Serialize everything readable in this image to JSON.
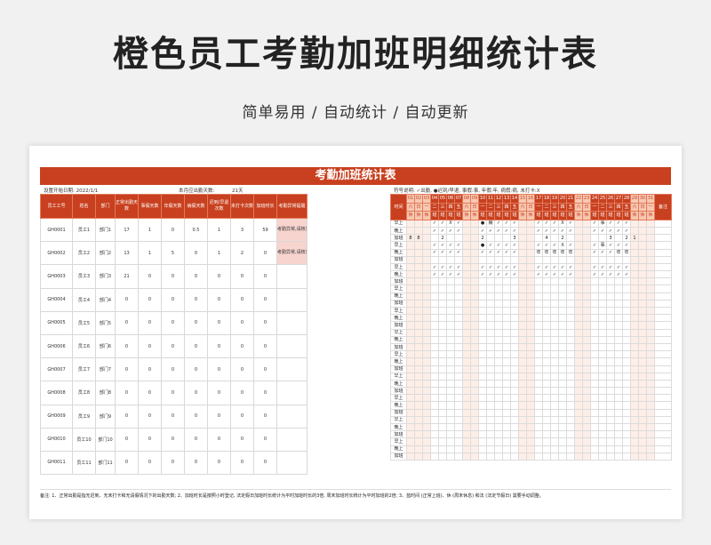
{
  "title": "橙色员工考勤加班明细统计表",
  "subtitle": "简单易用 / 自动统计 / 自动更新",
  "sheet": {
    "banner": "考勤加班统计表",
    "meta_start": "设置开始日期: 2022/1/1",
    "meta_days": "本月应出勤天数:",
    "meta_days_value": "21天",
    "meta_legend": "符号说明: ✓出勤, ●迟到/早退, 事假:事, 年假:年, 病假:病, 未打卡:X",
    "headers": [
      "员工工号",
      "姓名",
      "部门",
      "正常出勤天数",
      "事假天数",
      "年假天数",
      "病假天数",
      "迟到/早退次数",
      "未打卡次数",
      "加班时长",
      "考勤异常提醒",
      "时间"
    ],
    "employees": [
      {
        "id": "GH0001",
        "name": "员工1",
        "dept": "部门1",
        "normal": "17",
        "personal": "1",
        "annual": "0",
        "sick": "0.5",
        "late": "1",
        "missed": "3",
        "ot": "59",
        "remark": "考勤异常,请核实"
      },
      {
        "id": "GH0002",
        "name": "员工2",
        "dept": "部门2",
        "normal": "13",
        "personal": "1",
        "annual": "5",
        "sick": "0",
        "late": "1",
        "missed": "2",
        "ot": "0",
        "remark": "考勤异常,请核实"
      },
      {
        "id": "GH0003",
        "name": "员工3",
        "dept": "部门3",
        "normal": "21",
        "personal": "0",
        "annual": "0",
        "sick": "0",
        "late": "0",
        "missed": "0",
        "ot": "0",
        "remark": ""
      },
      {
        "id": "GH0004",
        "name": "员工4",
        "dept": "部门4",
        "normal": "0",
        "personal": "0",
        "annual": "0",
        "sick": "0",
        "late": "0",
        "missed": "0",
        "ot": "0",
        "remark": ""
      },
      {
        "id": "GH0005",
        "name": "员工5",
        "dept": "部门5",
        "normal": "0",
        "personal": "0",
        "annual": "0",
        "sick": "0",
        "late": "0",
        "missed": "0",
        "ot": "0",
        "remark": ""
      },
      {
        "id": "GH0006",
        "name": "员工6",
        "dept": "部门6",
        "normal": "0",
        "personal": "0",
        "annual": "0",
        "sick": "0",
        "late": "0",
        "missed": "0",
        "ot": "0",
        "remark": ""
      },
      {
        "id": "GH0007",
        "name": "员工7",
        "dept": "部门7",
        "normal": "0",
        "personal": "0",
        "annual": "0",
        "sick": "0",
        "late": "0",
        "missed": "0",
        "ot": "0",
        "remark": ""
      },
      {
        "id": "GH0008",
        "name": "员工8",
        "dept": "部门8",
        "normal": "0",
        "personal": "0",
        "annual": "0",
        "sick": "0",
        "late": "0",
        "missed": "0",
        "ot": "0",
        "remark": ""
      },
      {
        "id": "GH0009",
        "name": "员工9",
        "dept": "部门9",
        "normal": "0",
        "personal": "0",
        "annual": "0",
        "sick": "0",
        "late": "0",
        "missed": "0",
        "ot": "0",
        "remark": ""
      },
      {
        "id": "GH0010",
        "name": "员工10",
        "dept": "部门10",
        "normal": "0",
        "personal": "0",
        "annual": "0",
        "sick": "0",
        "late": "0",
        "missed": "0",
        "ot": "0",
        "remark": ""
      },
      {
        "id": "GH0011",
        "name": "员工11",
        "dept": "部门11",
        "normal": "0",
        "personal": "0",
        "annual": "0",
        "sick": "0",
        "late": "0",
        "missed": "0",
        "ot": "0",
        "remark": ""
      }
    ],
    "time_label": "时间",
    "remark_label": "备注",
    "slots": [
      "早上",
      "晚上",
      "加班"
    ],
    "days": [
      "01",
      "02",
      "03",
      "04",
      "05",
      "06",
      "07",
      "08",
      "09",
      "10",
      "11",
      "12",
      "13",
      "14",
      "15",
      "16",
      "17",
      "18",
      "19",
      "20",
      "21",
      "22",
      "23",
      "24",
      "25",
      "26",
      "27",
      "28",
      "29",
      "30",
      "31"
    ],
    "weekdays": [
      "六",
      "日",
      "一",
      "二",
      "三",
      "四",
      "五",
      "六",
      "日",
      "一",
      "二",
      "三",
      "四",
      "五",
      "六",
      "日",
      "一",
      "二",
      "三",
      "四",
      "五",
      "六",
      "日",
      "一",
      "二",
      "三",
      "四",
      "五",
      "六",
      "日",
      "一"
    ],
    "daytypes": [
      "休",
      "休",
      "休",
      "班",
      "班",
      "班",
      "班",
      "休",
      "休",
      "班",
      "班",
      "班",
      "班",
      "班",
      "休",
      "休",
      "班",
      "班",
      "班",
      "班",
      "班",
      "休",
      "休",
      "班",
      "班",
      "班",
      "班",
      "班",
      "休",
      "休",
      "休"
    ],
    "weekend_days": [
      0,
      1,
      2,
      7,
      8,
      14,
      15,
      21,
      22,
      28,
      29,
      30
    ],
    "marks": {
      "0": [
        [
          "",
          "",
          "",
          "✓",
          "✓",
          "X",
          "✓",
          "",
          "",
          "●",
          "病",
          "✓",
          "✓",
          "✓",
          "",
          "",
          "✓",
          "✓",
          "✓",
          "X",
          "✓",
          "",
          "",
          "✓",
          "事",
          "✓",
          "✓",
          "✓",
          "",
          "",
          ""
        ],
        [
          "",
          "",
          "",
          "✓",
          "✓",
          "✓",
          "✓",
          "",
          "",
          "✓",
          "✓",
          "✓",
          "✓",
          "✓",
          "",
          "",
          "✓",
          "✓",
          "✓",
          "✓",
          "✓",
          "",
          "",
          "✓",
          "✓",
          "✓",
          "✓",
          "✓",
          "",
          "",
          ""
        ],
        [
          "8",
          "8",
          "",
          "",
          "2",
          "",
          "",
          "",
          "",
          "2",
          "",
          "",
          "",
          "3",
          "",
          "",
          "",
          "4",
          "",
          "2",
          "",
          "",
          "",
          "",
          "",
          "3",
          "",
          "2",
          "1",
          "",
          ""
        ]
      ],
      "1": [
        [
          "",
          "",
          "",
          "✓",
          "✓",
          "✓",
          "✓",
          "",
          "",
          "●",
          "✓",
          "✓",
          "✓",
          "✓",
          "",
          "",
          "✓",
          "✓",
          "✓",
          "X",
          "✓",
          "",
          "",
          "✓",
          "事",
          "✓",
          "✓",
          "✓",
          "",
          "",
          ""
        ],
        [
          "",
          "",
          "",
          "✓",
          "✓",
          "✓",
          "✓",
          "",
          "",
          "✓",
          "✓",
          "✓",
          "✓",
          "✓",
          "",
          "",
          "年",
          "年",
          "年",
          "年",
          "年",
          "",
          "",
          "✓",
          "✓",
          "✓",
          "年",
          "年",
          "",
          "",
          ""
        ],
        [
          "",
          "",
          "",
          "",
          "",
          "",
          "",
          "",
          "",
          "",
          "",
          "",
          "",
          "",
          "",
          "",
          "",
          "",
          "",
          "",
          "",
          "",
          "",
          "",
          "",
          "",
          "",
          "",
          "",
          "",
          ""
        ]
      ],
      "2": [
        [
          "",
          "",
          "",
          "✓",
          "✓",
          "✓",
          "✓",
          "",
          "",
          "✓",
          "✓",
          "✓",
          "✓",
          "✓",
          "",
          "",
          "✓",
          "✓",
          "✓",
          "✓",
          "✓",
          "",
          "",
          "✓",
          "✓",
          "✓",
          "✓",
          "✓",
          "",
          "",
          ""
        ],
        [
          "",
          "",
          "",
          "✓",
          "✓",
          "✓",
          "✓",
          "",
          "",
          "✓",
          "✓",
          "✓",
          "✓",
          "✓",
          "",
          "",
          "✓",
          "✓",
          "✓",
          "✓",
          "✓",
          "",
          "",
          "✓",
          "✓",
          "✓",
          "✓",
          "✓",
          "",
          "",
          ""
        ],
        [
          "",
          "",
          "",
          "",
          "",
          "",
          "",
          "",
          "",
          "",
          "",
          "",
          "",
          "",
          "",
          "",
          "",
          "",
          "",
          "",
          "",
          "",
          "",
          "",
          "",
          "",
          "",
          "",
          "",
          "",
          ""
        ]
      ]
    },
    "footnote": "备注: 1、正常出勤是指无迟到、无未打卡和无请假情况下的出勤天数; 2、加班时长是按照小时登记, 法定假日加班时长统计为平时加班时长的3倍, 周末加班时长统计为平时加班的2倍; 3、蓝时间 (正常上班)、休 (周末休息) 和法 (法定节假日) 需要手动调整。"
  }
}
